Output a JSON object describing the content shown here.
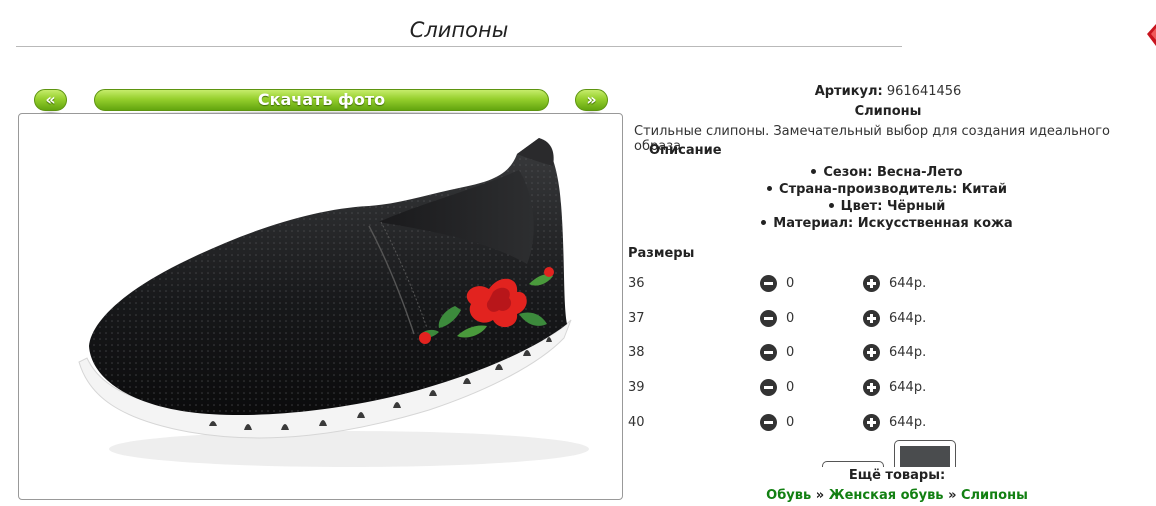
{
  "header": {
    "title": "Слипоны"
  },
  "nav": {
    "prev_label": "«",
    "download_label": "Скачать фото",
    "next_label": "»"
  },
  "product": {
    "sku_label": "Артикул:",
    "sku_value": "961641456",
    "name": "Слипоны",
    "description": "Стильные слипоны. Замечательный выбор для создания идеального образа",
    "description_heading": "Описание",
    "properties": [
      "Сезон: Весна-Лето",
      "Страна-производитель: Китай",
      "Цвет: Чёрный",
      "Материал: Искусственная кожа"
    ]
  },
  "sizes": {
    "heading": "Размеры",
    "rows": [
      {
        "size": "36",
        "qty": "0",
        "price": "644р."
      },
      {
        "size": "37",
        "qty": "0",
        "price": "644р."
      },
      {
        "size": "38",
        "qty": "0",
        "price": "644р."
      },
      {
        "size": "39",
        "qty": "0",
        "price": "644р."
      },
      {
        "size": "40",
        "qty": "0",
        "price": "644р."
      }
    ]
  },
  "more": {
    "label": "Ещё товары:",
    "breadcrumbs": [
      "Обувь",
      "Женская обувь",
      "Слипоны"
    ],
    "separator": "»"
  },
  "colors": {
    "button_green": "#7cc01f",
    "link_green": "#128012",
    "corner_red": "#d8202a"
  },
  "icons": {
    "minus": "minus-circle-icon",
    "plus": "plus-circle-icon",
    "corner": "red-diamond-icon"
  }
}
